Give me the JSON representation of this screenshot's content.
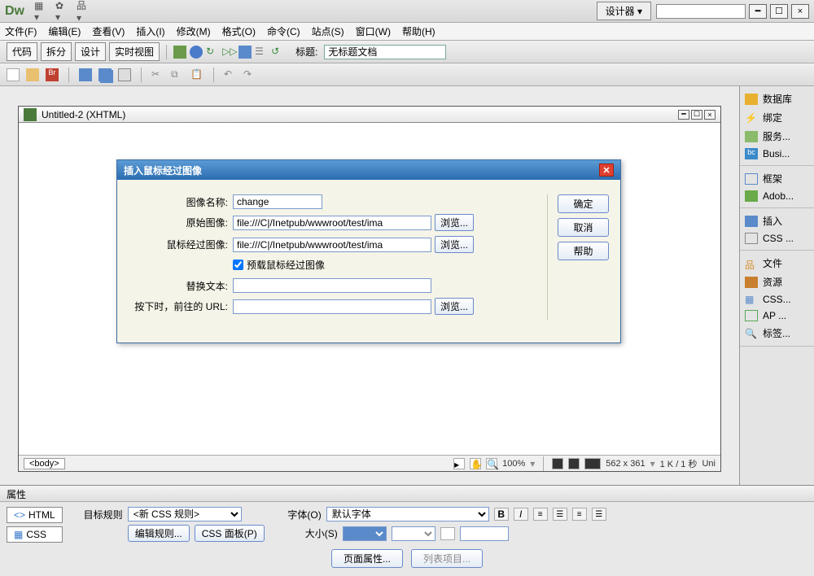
{
  "titlebar": {
    "designer": "设计器",
    "min": "━",
    "max": "☐",
    "close": "×"
  },
  "menu": [
    "文件(F)",
    "编辑(E)",
    "查看(V)",
    "插入(I)",
    "修改(M)",
    "格式(O)",
    "命令(C)",
    "站点(S)",
    "窗口(W)",
    "帮助(H)"
  ],
  "toolbar1": {
    "code": "代码",
    "split": "拆分",
    "design": "设计",
    "live": "实时视图",
    "title_lbl": "标题:",
    "title_val": "无标题文档"
  },
  "rightpanel": {
    "g1": [
      "数据库",
      "绑定",
      "服务...",
      "Busi..."
    ],
    "g2": [
      "框架",
      "Adob..."
    ],
    "g3": [
      "插入",
      "CSS ..."
    ],
    "g4": [
      "文件",
      "资源",
      "CSS...",
      "AP ...",
      "标签..."
    ]
  },
  "doc": {
    "title": "Untitled-2 (XHTML)",
    "body_tag": "<body>",
    "zoom": "100%",
    "dims": "562 x 361",
    "size": "1 K / 1 秒",
    "enc": "Uni"
  },
  "modal": {
    "title": "插入鼠标经过图像",
    "ok": "确定",
    "cancel": "取消",
    "help": "帮助",
    "browse": "浏览...",
    "name_lbl": "图像名称:",
    "name_val": "change",
    "orig_lbl": "原始图像:",
    "orig_val": "file:///C|/Inetpub/wwwroot/test/ima",
    "over_lbl": "鼠标经过图像:",
    "over_val": "file:///C|/Inetpub/wwwroot/test/ima",
    "preload_lbl": "预载鼠标经过图像",
    "alt_lbl": "替换文本:",
    "alt_val": "",
    "url_lbl": "按下时，前往的 URL:",
    "url_val": ""
  },
  "props": {
    "title": "属性",
    "html_tab": "HTML",
    "css_tab": "CSS",
    "rule_lbl": "目标规则",
    "rule_val": "<新 CSS 规则>",
    "edit_rule": "编辑规则...",
    "css_panel": "CSS 面板(P)",
    "font_lbl": "字体(O)",
    "font_val": "默认字体",
    "size_lbl": "大小(S)",
    "pageprops": "页面属性...",
    "listitem": "列表项目..."
  }
}
